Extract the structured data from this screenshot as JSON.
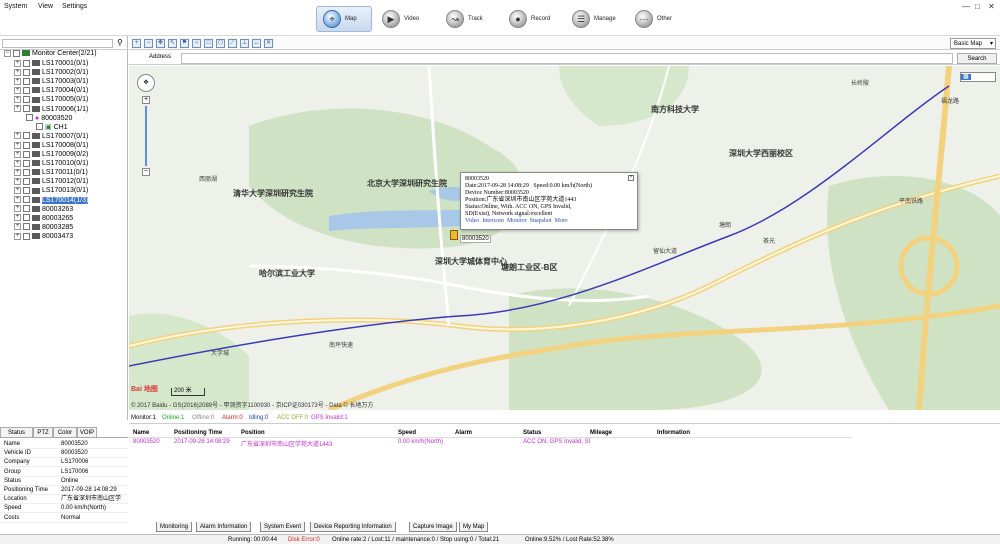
{
  "menu": {
    "system": "System",
    "view": "View",
    "settings": "Settings"
  },
  "window_controls": {
    "minimize": "—",
    "maximize": "□",
    "close": "✕"
  },
  "nav": [
    {
      "label": "Map",
      "active": true
    },
    {
      "label": "Video",
      "active": false
    },
    {
      "label": "Track",
      "active": false
    },
    {
      "label": "Record",
      "active": false
    },
    {
      "label": "Manage",
      "active": false
    },
    {
      "label": "Other",
      "active": false
    }
  ],
  "tree": {
    "root": "Monitor Center(2/21)",
    "items": [
      {
        "label": "LS170001(0/1)",
        "level": 1
      },
      {
        "label": "LS170002(0/1)",
        "level": 1
      },
      {
        "label": "LS170003(0/1)",
        "level": 1
      },
      {
        "label": "LS170004(0/1)",
        "level": 1
      },
      {
        "label": "LS170005(0/1)",
        "level": 1
      },
      {
        "label": "LS170006(1/1)",
        "level": 1
      },
      {
        "label": "80003520",
        "level": 2
      },
      {
        "label": "CH1",
        "level": 3
      },
      {
        "label": "LS170007(0/1)",
        "level": 1
      },
      {
        "label": "LS170008(0/1)",
        "level": 1
      },
      {
        "label": "LS170009(0/2)",
        "level": 1
      },
      {
        "label": "LS170010(0/1)",
        "level": 1
      },
      {
        "label": "LS170011(0/1)",
        "level": 1
      },
      {
        "label": "LS170012(0/1)",
        "level": 1
      },
      {
        "label": "LS170013(0/1)",
        "level": 1
      },
      {
        "label": "LS170014(1/3)",
        "level": 1,
        "selected": true
      },
      {
        "label": "80003263",
        "level": 1
      },
      {
        "label": "80003265",
        "level": 1
      },
      {
        "label": "80003285",
        "level": 1
      },
      {
        "label": "80003473",
        "level": 1
      }
    ]
  },
  "info_tabs": [
    "Status",
    "PTZ",
    "Color",
    "VOIP"
  ],
  "info": [
    {
      "k": "Name",
      "v": "80003520"
    },
    {
      "k": "Vehicle ID",
      "v": "80003520"
    },
    {
      "k": "Company",
      "v": "LS170006"
    },
    {
      "k": "Group",
      "v": "LS170006"
    },
    {
      "k": "Status",
      "v": "Online"
    },
    {
      "k": "Positioning Time",
      "v": "2017-09-28 14:08:29"
    },
    {
      "k": "Location",
      "v": "广东省深圳市南山区学"
    },
    {
      "k": "Speed",
      "v": "0.00 km/h(North)"
    },
    {
      "k": "Costs",
      "v": "Normal"
    }
  ],
  "map": {
    "address_label": "Address",
    "search_label": "Search",
    "map_type": "Basic Map",
    "scale": "200 米",
    "copyright": "© 2017 Baidu - GS(2016)2089号 - 甲测资字1100930 - 京ICP证030173号 - Data © 长地万方",
    "logo": "Bai 地图",
    "labels": [
      {
        "t": "南方科技大学",
        "c": "pl-1"
      },
      {
        "t": "北京大学深圳研究生院",
        "c": "pl-2"
      },
      {
        "t": "清华大学深圳研究生院",
        "c": "pl-3"
      },
      {
        "t": "深圳大学西丽校区",
        "c": "pl-4"
      },
      {
        "t": "哈尔滨工业大学",
        "c": "pl-5"
      },
      {
        "t": "深圳大学城体育中心",
        "c": "pl-6"
      },
      {
        "t": "塘朗工业区-B区",
        "c": "pl-7"
      },
      {
        "t": "西丽湖",
        "c": "pl-8"
      },
      {
        "t": "大学城",
        "c": "pl-9"
      },
      {
        "t": "塘朗",
        "c": "pl-10"
      },
      {
        "t": "留仙大道",
        "c": "pl-11"
      },
      {
        "t": "茶光",
        "c": "pl-12"
      },
      {
        "t": "南坪快速",
        "c": "pl-13"
      },
      {
        "t": "长岭陂",
        "c": "pl-14"
      },
      {
        "t": "福龙路",
        "c": "pl-15"
      },
      {
        "t": "平南铁路",
        "c": "pl-16"
      }
    ],
    "marker_label": "80003520",
    "popup": {
      "id": "80003520",
      "date": "Date:2017-09-28 14:08:29",
      "speed": "Speed:0.00 km/h(North)",
      "device": "Device Number:80003520",
      "position": "Position:广东省深圳市南山区学苑大道1443",
      "status": "Status:Online, With. ACC ON, GPS Invalid,",
      "sd": "SD(Exist), Network signal:excellent",
      "links": [
        "Video",
        "Intercom",
        "Monitor",
        "Snapshot",
        "More"
      ]
    }
  },
  "monitor": {
    "all": "Monitor:1",
    "online": "Online:1",
    "offline": "Offline:0",
    "alarm": "Alarm:0",
    "idling": "Idling:0",
    "accoff": "ACC OFF:0",
    "gpsinvalid": "GPS Invalid:1",
    "columns": [
      "Name",
      "Positioning Time",
      "Position",
      "Speed",
      "Alarm",
      "Status",
      "Mileage",
      "Information"
    ],
    "row": {
      "name": "80003520",
      "time": "2017-09-28 14:08:29",
      "position": "广东省深圳市南山区学苑大道1443",
      "speed": "0.00 km/h(North)",
      "alarm": "",
      "status": "ACC ON, GPS Invalid, SI",
      "mileage": "",
      "information": ""
    }
  },
  "bottom_tabs": [
    "Monitoring",
    "Alarm Information",
    "System Event",
    "Device Reporting Information",
    "Capture Image",
    "My Map"
  ],
  "status": {
    "running": "Running: 00:00:44",
    "disk": "Disk Error:0",
    "online_rate": "Online rate:2 / Lost:11 / maintenance:0 / Stop using:0 / Total:21",
    "online_pct": "Online:9.52% / Lost Rate:52.38%"
  },
  "colors": {
    "accent": "#3c74c8",
    "online": "#1fa51f",
    "alarm": "#d62020",
    "row": "#c22bd8"
  }
}
